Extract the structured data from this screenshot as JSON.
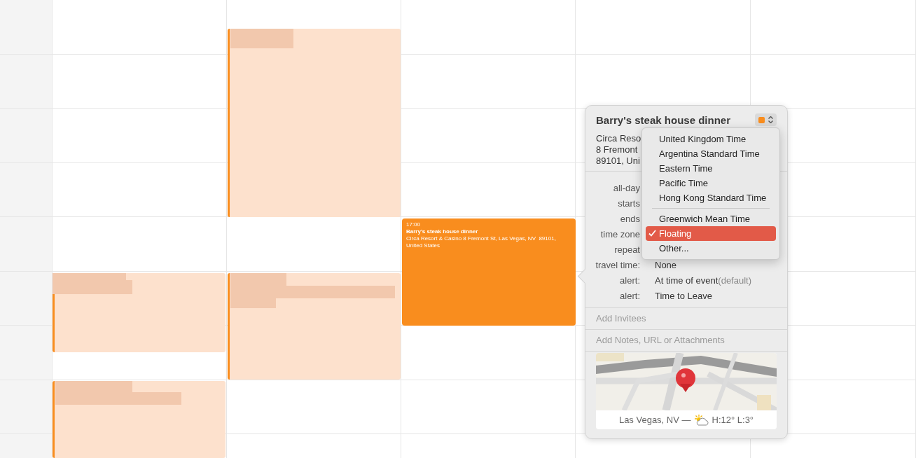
{
  "event": {
    "time": "17:00",
    "title": "Barry's steak house dinner",
    "location": "Circa Resort & Casino 8 Fremont St, Las Vegas, NV  89101, United States"
  },
  "popover": {
    "title": "Barry's steak house dinner",
    "location_lines": [
      "Circa Reso",
      "8 Fremont",
      "89101, Uni"
    ],
    "fields": [
      {
        "label": "all-day"
      },
      {
        "label": "starts"
      },
      {
        "label": "ends"
      },
      {
        "label": "time zone"
      },
      {
        "label": "repeat"
      },
      {
        "label": "travel time:",
        "value": "None"
      },
      {
        "label": "alert:",
        "value": "At time of event",
        "note": "(default)"
      },
      {
        "label": "alert:",
        "value": "Time to Leave"
      }
    ],
    "invitees_placeholder": "Add Invitees",
    "notes_placeholder": "Add Notes, URL or Attachments",
    "map": {
      "kind": "picture",
      "caption": "Las Vegas, NV —",
      "weather": "H:12° L:3°"
    }
  },
  "timezone_menu": {
    "groups": [
      [
        {
          "label": "United Kingdom Time",
          "selected": false
        },
        {
          "label": "Argentina Standard Time",
          "selected": false
        },
        {
          "label": "Eastern Time",
          "selected": false
        },
        {
          "label": "Pacific Time",
          "selected": false
        },
        {
          "label": "Hong Kong Standard Time",
          "selected": false
        }
      ],
      [
        {
          "label": "Greenwich Mean Time",
          "selected": false
        },
        {
          "label": "Floating",
          "selected": true
        },
        {
          "label": "Other...",
          "selected": false
        }
      ]
    ]
  }
}
